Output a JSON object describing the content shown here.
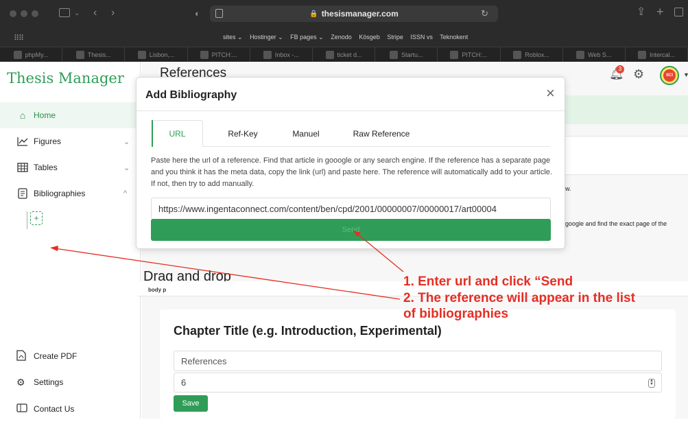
{
  "browser": {
    "url": "thesismanager.com",
    "favorites": [
      "sites ⌄",
      "Hostinger ⌄",
      "FB pages ⌄",
      "Zenodo",
      "Kösgeb",
      "Stripe",
      "ISSN vs",
      "Teknokent"
    ],
    "tabs": [
      "phpMy...",
      "Thesis...",
      "Lisbon,...",
      "PITCH:...",
      "Inbox -...",
      "ticket d...",
      "Startu...",
      "PITCH:...",
      "Roblox...",
      "Web S...",
      "Intercal..."
    ]
  },
  "sidebar": {
    "brand": "Thesis Manager",
    "items": [
      {
        "label": "Home",
        "icon": "home-icon"
      },
      {
        "label": "Figures",
        "icon": "chart-line-icon"
      },
      {
        "label": "Tables",
        "icon": "table-icon"
      },
      {
        "label": "Bibliographies",
        "icon": "bibliography-icon"
      }
    ],
    "bottom_items": [
      {
        "label": "Create PDF",
        "icon": "pdf-icon"
      },
      {
        "label": "Settings",
        "icon": "gear-icon"
      },
      {
        "label": "Contact Us",
        "icon": "contact-card-icon"
      }
    ]
  },
  "header": {
    "page_title": "References",
    "notification_count": "3",
    "avatar_text": "SCI"
  },
  "modal": {
    "title": "Add Bibliography",
    "tabs": [
      "URL",
      "Ref-Key",
      "Manuel",
      "Raw Reference"
    ],
    "active_tab": "URL",
    "help_text": "Paste here the url of a reference. Find that article in gooogle or any search engine. If the reference has a separate page and you think it has the meta data, copy the link (url) and paste here. The reference will automatically add to your article. If not, then try to add manually.",
    "url_value": "https://www.ingentaconnect.com/content/ben/cpd/2001/00000007/00000017/art00004",
    "send_label": "Send"
  },
  "background": {
    "text_fragment_1": "w.",
    "text_fragment_2": "google and find the exact page of the",
    "dnd_title": "Drag and drop",
    "path_label": "body  p"
  },
  "chapter": {
    "title": "Chapter Title (e.g. Introduction, Experimental)",
    "ref_input_value": "References",
    "number_value": "6",
    "save_label": "Save"
  },
  "annotations": {
    "line1": "1. Enter url and click “Send",
    "line2": "2. The reference will appear in the list",
    "line3": "of bibliographies",
    "color": "#e52e23"
  }
}
